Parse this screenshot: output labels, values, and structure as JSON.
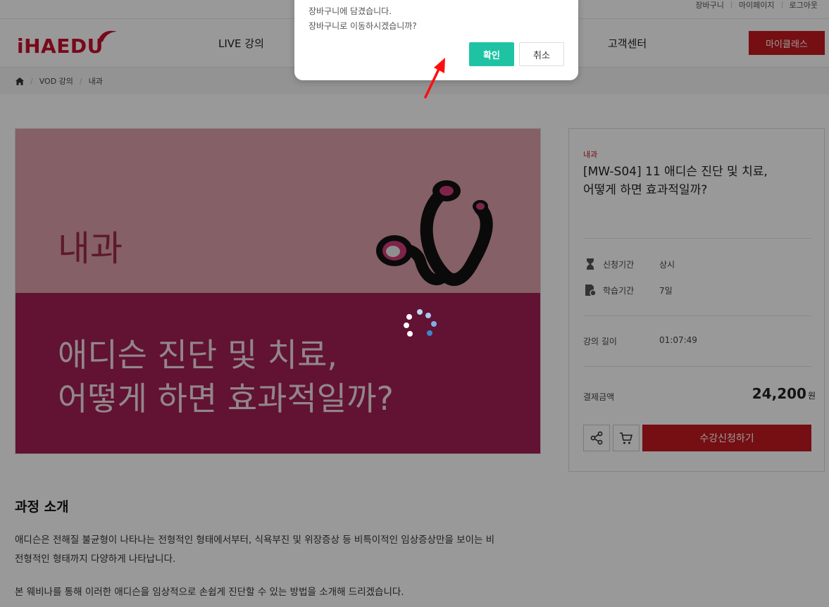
{
  "topbar": {
    "links": [
      "장바구니",
      "마이페이지",
      "로그아웃"
    ]
  },
  "header": {
    "logo": "iHAEDU",
    "nav": [
      "LIVE 강의",
      "고객센터"
    ],
    "myclass_label": "마이클래스"
  },
  "breadcrumb": {
    "items": [
      "VOD 강의",
      "내과"
    ]
  },
  "hero": {
    "category": "내과",
    "title_line1": "애디슨 진단 및 치료,",
    "title_line2": "어떻게 하면 효과적일까?"
  },
  "course": {
    "category": "내과",
    "title": "[MW-S04] 11 애디슨 진단 및 치료, 어떻게 하면 효과적일까?",
    "apply_period_label": "신청기간",
    "apply_period_value": "상시",
    "study_period_label": "학습기간",
    "study_period_value": "7일",
    "length_label": "강의 길이",
    "length_value": "01:07:49",
    "price_label": "결제금액",
    "price_value": "24,200",
    "price_unit": "원",
    "apply_button": "수강신청하기"
  },
  "intro": {
    "heading": "과정 소개",
    "para1_line1": "애디슨은 전해질 불균형이 나타나는 전형적인 형태에서부터, 식욕부진 및 위장증상 등 비특이적인 임상증상만을 보이는 비",
    "para1_line2": "전형적인 형태까지 다양하게 나타납니다.",
    "para2": "본 웨비나를 통해 이러한 애디슨을 임상적으로 손쉽게 진단할 수 있는 방법을 소개해 드리겠습니다."
  },
  "dialog": {
    "line1": "장바구니에 담겼습니다.",
    "line2": "장바구니로 이동하시겠습니까?",
    "confirm": "확인",
    "cancel": "취소"
  },
  "colors": {
    "brand_red": "#c41a20",
    "confirm_teal": "#1ec3a4",
    "hero_pink": "#dea0aa",
    "hero_wine": "#a31e54"
  },
  "icons": [
    "home-icon",
    "hourglass-icon",
    "document-icon",
    "share-icon",
    "cart-icon",
    "loading-spinner-icon",
    "red-arrow-annotation"
  ]
}
